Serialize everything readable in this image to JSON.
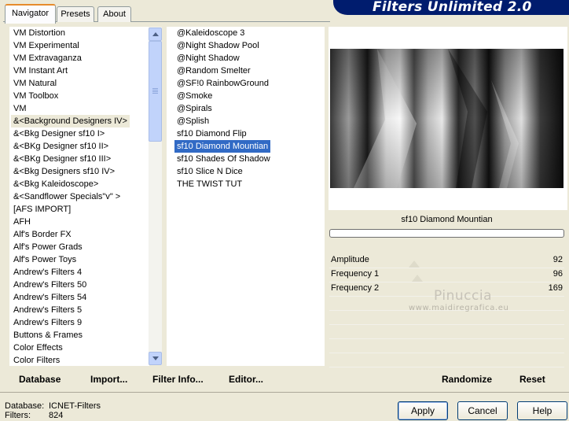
{
  "header": {
    "banner_title": "Filters Unlimited 2.0",
    "tabs": [
      {
        "label": "Navigator",
        "active": true
      },
      {
        "label": "Presets",
        "active": false
      },
      {
        "label": "About",
        "active": false
      }
    ]
  },
  "category_list": {
    "items": [
      "VM Distortion",
      "VM Experimental",
      "VM Extravaganza",
      "VM Instant Art",
      "VM Natural",
      "VM Toolbox",
      "VM",
      "&<Background Designers IV>",
      "&<Bkg Designer sf10 I>",
      "&<BKg Designer sf10 II>",
      "&<BKg Designer sf10 III>",
      "&<Bkg Designers sf10 IV>",
      "&<Bkg Kaleidoscope>",
      "&<Sandflower Specials\"v\" >",
      "[AFS IMPORT]",
      "AFH",
      "Alf's Border FX",
      "Alf's Power Grads",
      "Alf's Power Toys",
      "Andrew's Filters 4",
      "Andrew's Filters 50",
      "Andrew's Filters 54",
      "Andrew's Filters 5",
      "Andrew's Filters 9",
      "Buttons & Frames",
      "Color Effects",
      "Color Filters"
    ],
    "selected": "&<Background Designers IV>"
  },
  "filter_list": {
    "items": [
      "@Kaleidoscope 3",
      "@Night Shadow Pool",
      "@Night Shadow",
      "@Random Smelter",
      "@SF!0 RainbowGround",
      "@Smoke",
      "@Spirals",
      "@Splish",
      "sf10 Diamond Flip",
      "sf10 Diamond Mountian",
      "sf10 Shades Of Shadow",
      "sf10 Slice N Dice",
      "THE TWIST TUT"
    ],
    "selected": "sf10 Diamond Mountian"
  },
  "preview": {
    "filter_name": "sf10 Diamond Mountian",
    "progress": 0,
    "watermark_name": "Pinuccia",
    "watermark_url": "www.maidiregrafica.eu"
  },
  "parameters": [
    {
      "label": "Amplitude",
      "value": "92"
    },
    {
      "label": "Frequency 1",
      "value": "96"
    },
    {
      "label": "Frequency 2",
      "value": "169"
    }
  ],
  "toolbar": {
    "database": "Database",
    "import": "Import...",
    "filter_info": "Filter Info...",
    "editor": "Editor...",
    "randomize": "Randomize",
    "reset": "Reset"
  },
  "status": {
    "database_label": "Database:",
    "database_value": "ICNET-Filters",
    "filters_label": "Filters:",
    "filters_value": "824"
  },
  "dialog_buttons": {
    "apply": "Apply",
    "cancel": "Cancel",
    "help": "Help"
  },
  "colors": {
    "banner": "#001c6e",
    "selection": "#316ac5",
    "tab_accent": "#e68b2c"
  }
}
